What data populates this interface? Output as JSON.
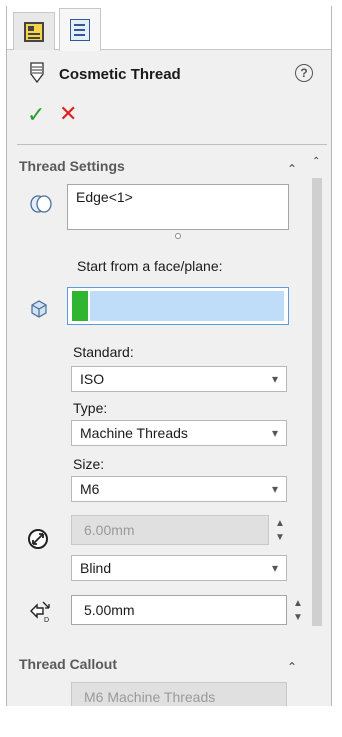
{
  "header": {
    "title": "Cosmetic Thread",
    "help_glyph": "?"
  },
  "actions": {
    "ok_glyph": "✓",
    "cancel_glyph": "✕"
  },
  "thread_settings": {
    "section_title": "Thread Settings",
    "edge_value": "Edge<1>",
    "start_label": "Start from a face/plane:",
    "standard_label": "Standard:",
    "standard_value": "ISO",
    "type_label": "Type:",
    "type_value": "Machine Threads",
    "size_label": "Size:",
    "size_value": "M6",
    "diameter_value": "6.00mm",
    "end_condition_value": "Blind",
    "depth_value": "5.00mm"
  },
  "thread_callout": {
    "section_title": "Thread Callout",
    "callout_value": "M6 Machine Threads"
  },
  "icons": {
    "tab1": "property-manager-icon",
    "tab2": "feature-list-icon",
    "thread": "cosmetic-thread-icon",
    "edge": "edge-selection-icon",
    "face": "face-selection-icon",
    "diameter": "diameter-icon",
    "depth": "depth-icon"
  },
  "colors": {
    "ok": "#2aa02a",
    "cancel": "#e02020",
    "selection_box": "#bfdcf8",
    "selection_marker": "#2fb52f"
  }
}
